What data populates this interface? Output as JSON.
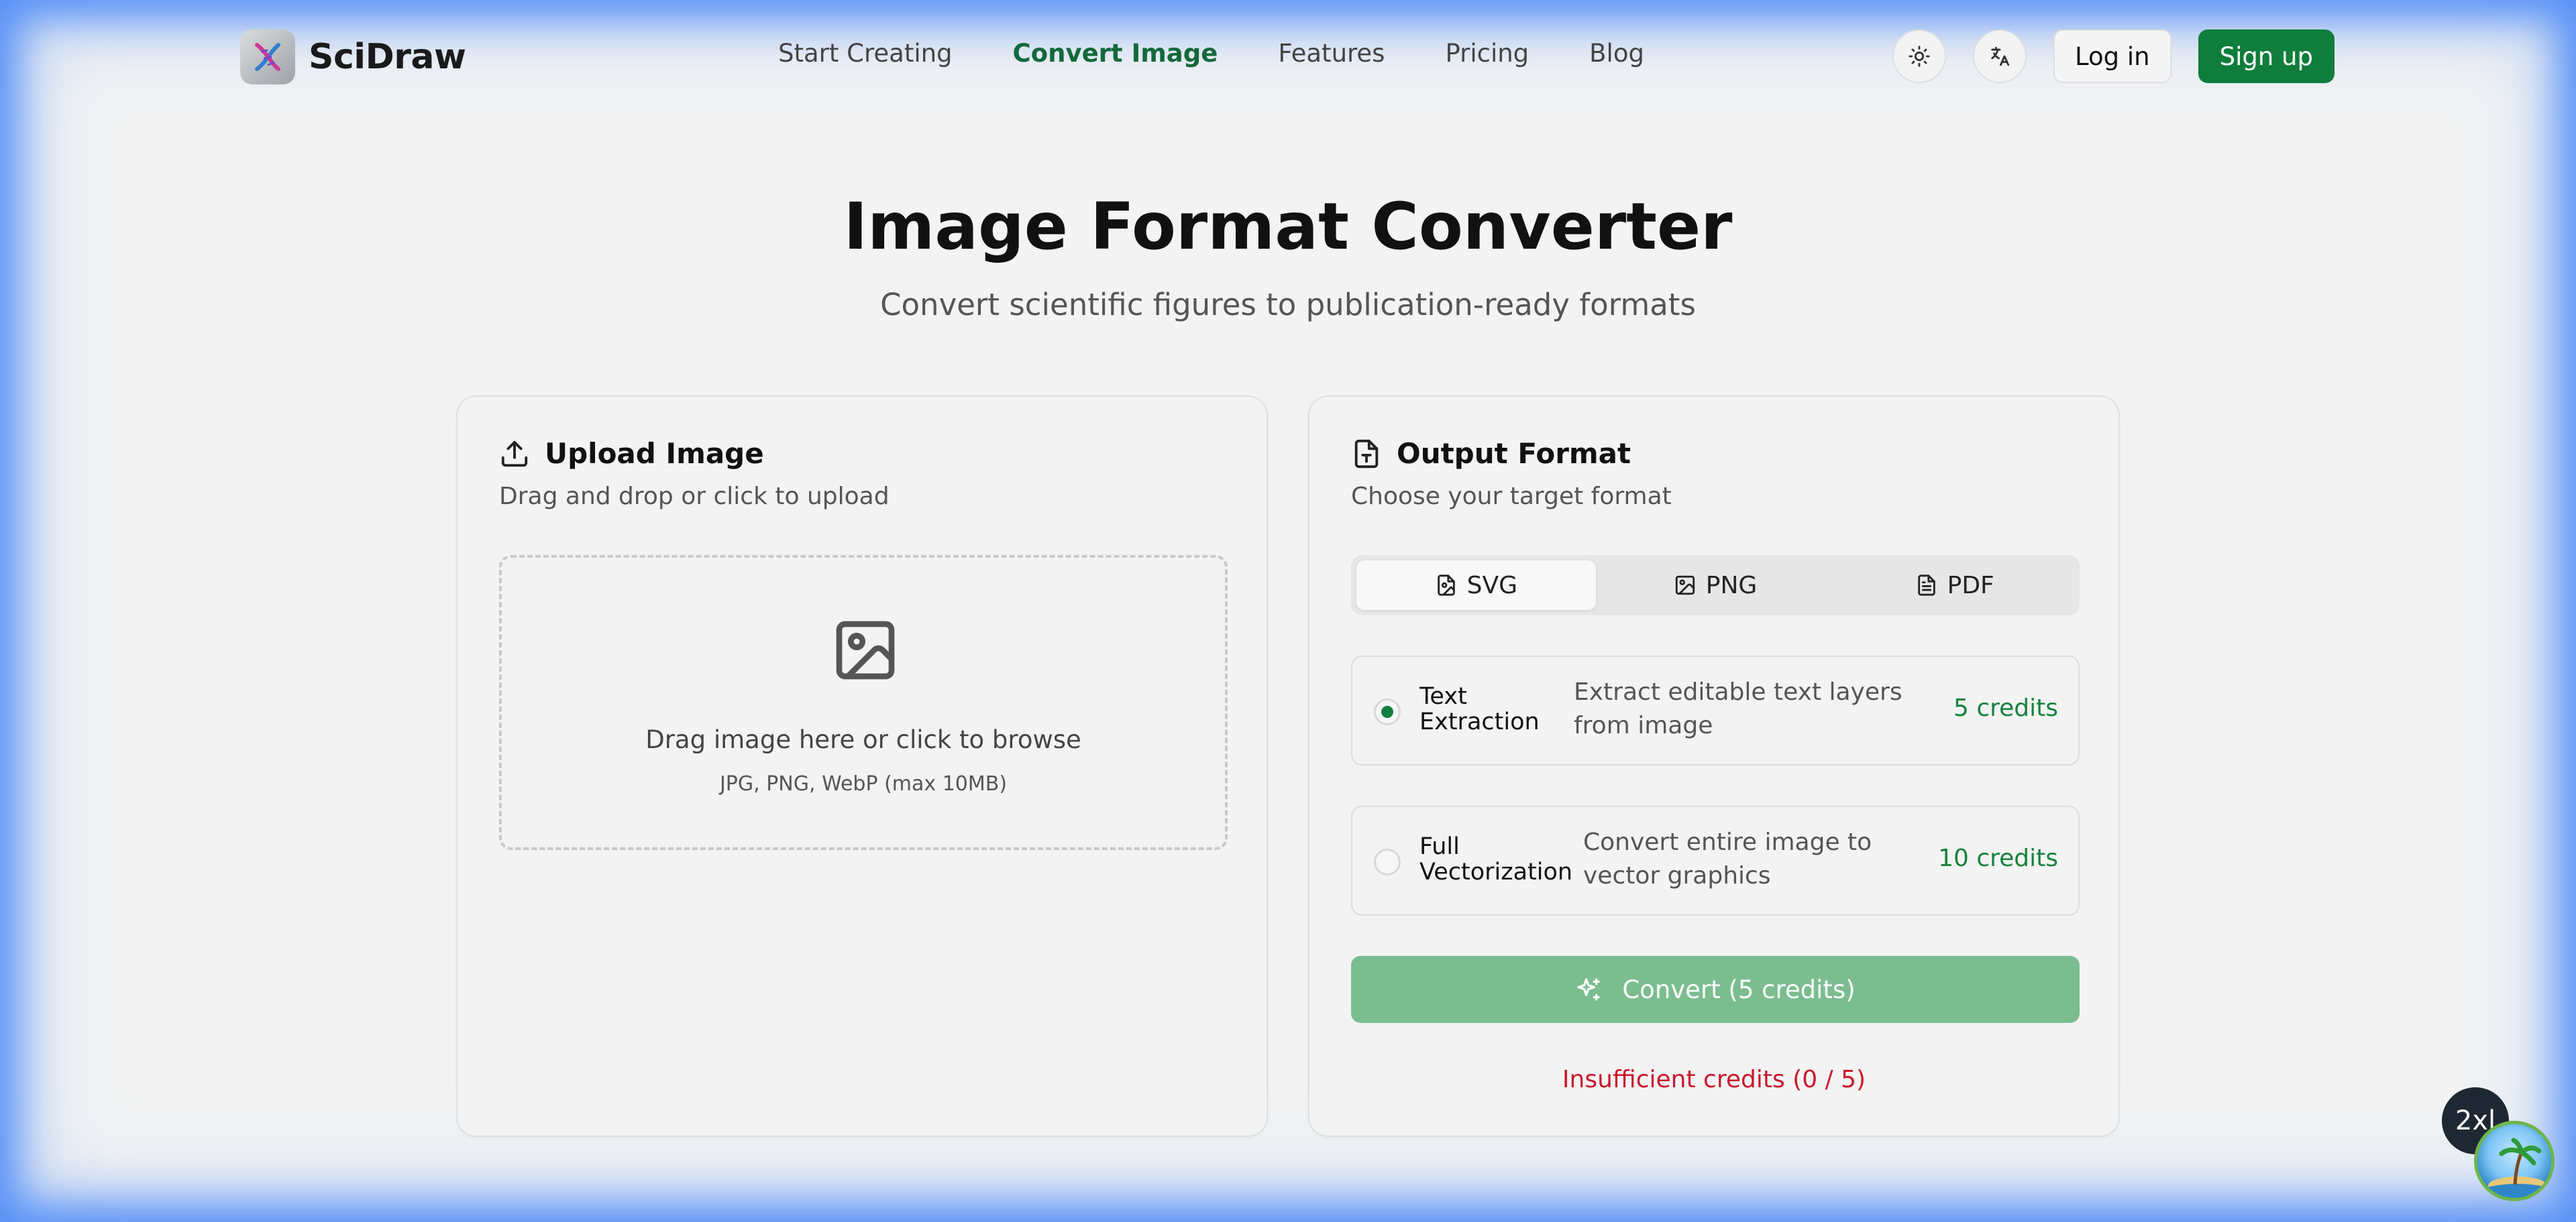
{
  "brand": {
    "name": "SciDraw"
  },
  "nav": [
    {
      "label": "Start Creating",
      "active": false
    },
    {
      "label": "Convert Image",
      "active": true
    },
    {
      "label": "Features",
      "active": false
    },
    {
      "label": "Pricing",
      "active": false
    },
    {
      "label": "Blog",
      "active": false
    }
  ],
  "header": {
    "theme_icon": "sun-icon",
    "language_icon": "translate-icon",
    "login_label": "Log in",
    "signup_label": "Sign up"
  },
  "hero": {
    "title": "Image Format Converter",
    "subtitle": "Convert scientific figures to publication-ready formats"
  },
  "upload": {
    "title": "Upload Image",
    "description": "Drag and drop or click to upload",
    "drop_text": "Drag image here or click to browse",
    "drop_hint": "JPG, PNG, WebP (max 10MB)"
  },
  "output": {
    "title": "Output Format",
    "description": "Choose your target format",
    "tabs": [
      {
        "label": "SVG",
        "active": true,
        "icon": "file-image-icon"
      },
      {
        "label": "PNG",
        "active": false,
        "icon": "image-icon"
      },
      {
        "label": "PDF",
        "active": false,
        "icon": "file-text-icon"
      }
    ],
    "options": [
      {
        "name_line1": "Text",
        "name_line2": "Extraction",
        "description": "Extract editable text layers from image",
        "credits": "5 credits",
        "selected": true
      },
      {
        "name_line1": "Full",
        "name_line2": "Vectorization",
        "description": "Convert entire image to vector graphics",
        "credits": "10 credits",
        "selected": false
      }
    ],
    "convert_label": "Convert (5 credits)",
    "insufficient": "Insufficient credits (0 / 5)"
  },
  "badges": {
    "breakpoint": "2xl"
  },
  "colors": {
    "accent": "#0f7d3b",
    "error": "#c9182b",
    "convert_disabled": "#7bbd8f"
  }
}
